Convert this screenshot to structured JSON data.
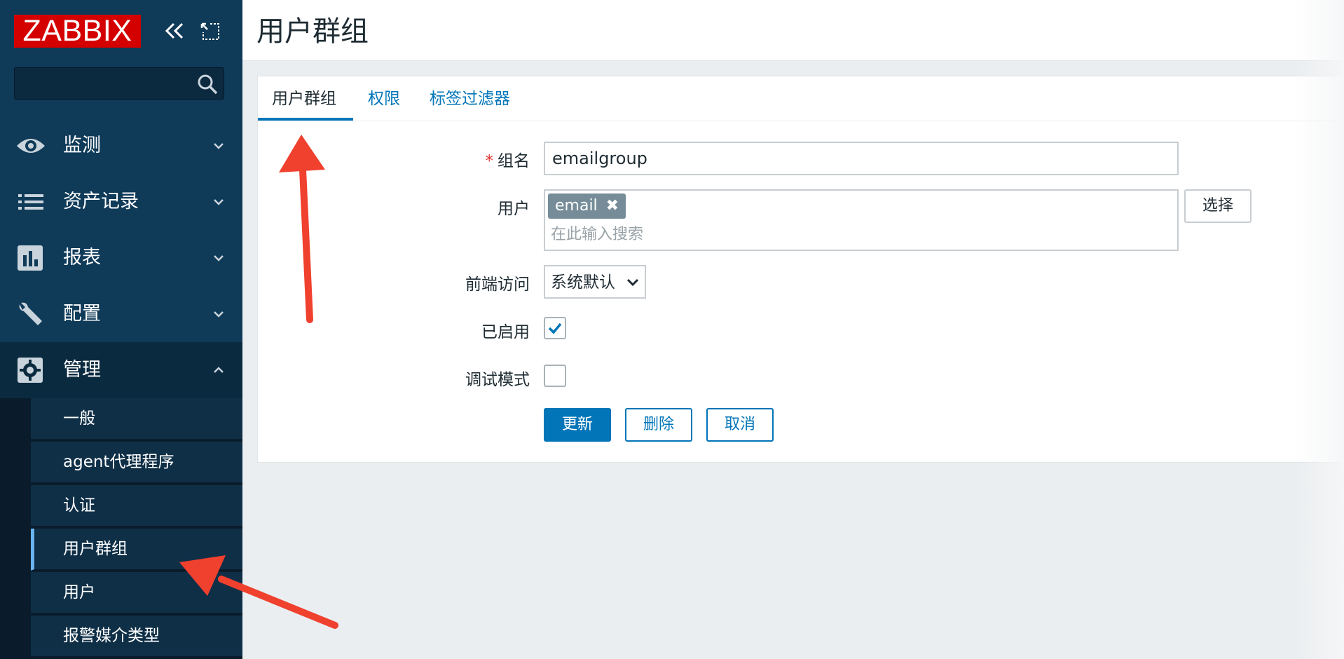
{
  "brand": {
    "logo_text": "ZABBIX"
  },
  "sidebar": {
    "search": {
      "value": "",
      "placeholder": ""
    },
    "menu": [
      {
        "label": "监测",
        "icon": "eye-icon"
      },
      {
        "label": "资产记录",
        "icon": "list-icon"
      },
      {
        "label": "报表",
        "icon": "bar-chart-icon"
      },
      {
        "label": "配置",
        "icon": "wrench-icon"
      },
      {
        "label": "管理",
        "icon": "gear-icon",
        "expanded": true
      }
    ],
    "submenu": [
      {
        "label": "一般"
      },
      {
        "label": "agent代理程序"
      },
      {
        "label": "认证"
      },
      {
        "label": "用户群组",
        "selected": true
      },
      {
        "label": "用户"
      },
      {
        "label": "报警媒介类型"
      }
    ]
  },
  "page": {
    "title": "用户群组"
  },
  "tabs": [
    {
      "label": "用户群组",
      "active": true
    },
    {
      "label": "权限"
    },
    {
      "label": "标签过滤器"
    }
  ],
  "form": {
    "group_name": {
      "required_mark": "*",
      "label": "组名",
      "value": "emailgroup"
    },
    "users": {
      "label": "用户",
      "chips": [
        "email"
      ],
      "chip_remove": "✖",
      "placeholder": "在此输入搜索",
      "select_button": "选择"
    },
    "frontend_access": {
      "label": "前端访问",
      "value": "系统默认"
    },
    "enabled": {
      "label": "已启用",
      "checked": true
    },
    "debug_mode": {
      "label": "调试模式",
      "checked": false
    },
    "buttons": {
      "update": "更新",
      "delete": "删除",
      "cancel": "取消"
    }
  },
  "colors": {
    "sidebar_bg": "#0f3a58",
    "logo_red": "#d40000",
    "accent_blue": "#0275b8",
    "annotation_arrow": "#f0402e"
  }
}
